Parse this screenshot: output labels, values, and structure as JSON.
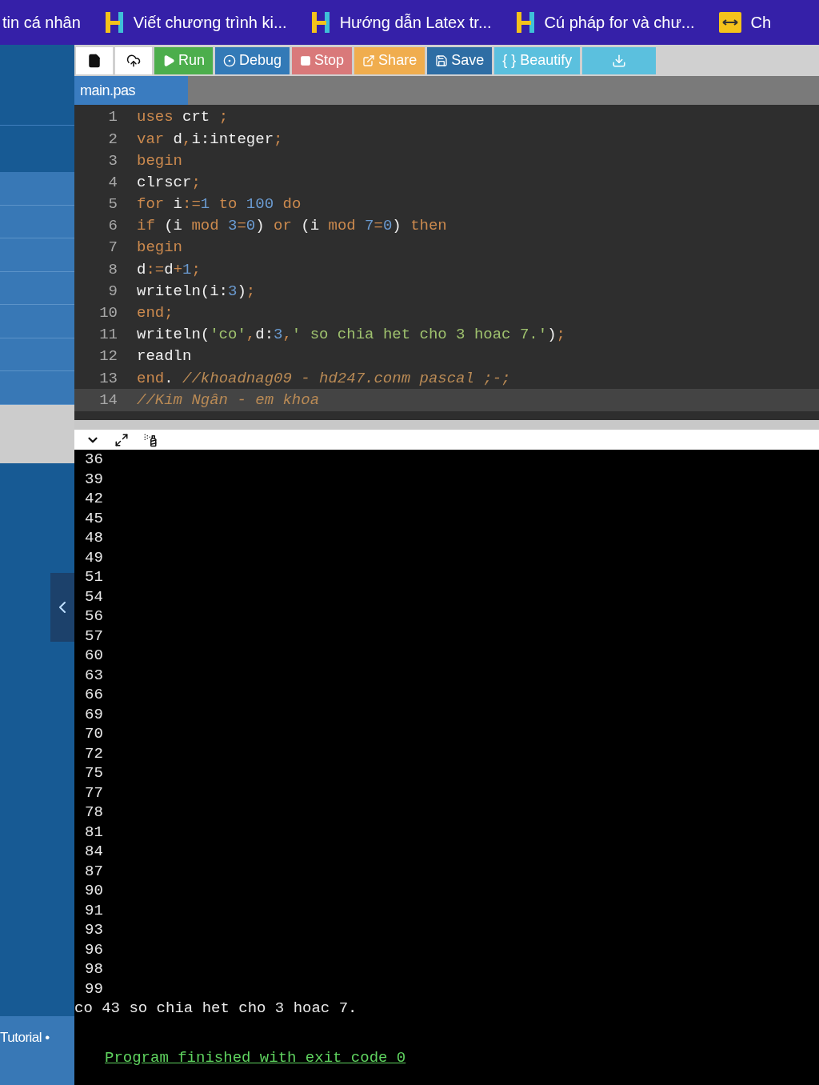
{
  "bookmarks_bar": {
    "items": [
      {
        "label": "tin cá nhân",
        "kind": "text"
      },
      {
        "label": "Viết chương trình ki...",
        "kind": "h-logo"
      },
      {
        "label": "Hướng dẫn Latex tr...",
        "kind": "h-logo"
      },
      {
        "label": "Cú pháp for và chư...",
        "kind": "h-logo"
      },
      {
        "label": "Ch",
        "kind": "arrows"
      }
    ]
  },
  "sidebar": {
    "footer_link": "Tutorial •"
  },
  "toolbar": {
    "buttons": [
      {
        "kind": "new-file",
        "color": "#ffffff"
      },
      {
        "kind": "upload",
        "color": "#ffffff"
      },
      {
        "kind": "run",
        "label": "Run",
        "color": "#4cae4c"
      },
      {
        "kind": "debug",
        "label": "Debug",
        "color": "#337ab7"
      },
      {
        "kind": "stop",
        "label": "Stop",
        "color": "#d9797a"
      },
      {
        "kind": "share",
        "label": "Share",
        "color": "#f0ad4e"
      },
      {
        "kind": "save",
        "label": "Save",
        "color": "#2e6da4"
      },
      {
        "kind": "beautify",
        "label": "{ } Beautify",
        "color": "#5bc0de"
      },
      {
        "kind": "download",
        "color": "#5bc0de"
      }
    ]
  },
  "tabs": [
    {
      "label": "main.pas",
      "selected": true
    }
  ],
  "editor": {
    "lines": [
      {
        "number": "1",
        "active": false,
        "tokens": [
          {
            "text": "uses",
            "kind": "keyword"
          },
          {
            "text": " crt ",
            "kind": "plain"
          },
          {
            "text": ";",
            "kind": "punct"
          }
        ]
      },
      {
        "number": "2",
        "active": false,
        "tokens": [
          {
            "text": "var",
            "kind": "keyword"
          },
          {
            "text": " d",
            "kind": "plain"
          },
          {
            "text": ",",
            "kind": "punct"
          },
          {
            "text": "i:integer",
            "kind": "plain"
          },
          {
            "text": ";",
            "kind": "punct"
          }
        ]
      },
      {
        "number": "3",
        "active": false,
        "tokens": [
          {
            "text": "begin",
            "kind": "keyword"
          }
        ]
      },
      {
        "number": "4",
        "active": false,
        "tokens": [
          {
            "text": "clrscr",
            "kind": "plain"
          },
          {
            "text": ";",
            "kind": "punct"
          }
        ]
      },
      {
        "number": "5",
        "active": false,
        "tokens": [
          {
            "text": "for",
            "kind": "keyword"
          },
          {
            "text": " i",
            "kind": "plain"
          },
          {
            "text": ":=",
            "kind": "punct"
          },
          {
            "text": "1",
            "kind": "number"
          },
          {
            "text": " to",
            "kind": "keyword"
          },
          {
            "text": " 100",
            "kind": "number"
          },
          {
            "text": " do",
            "kind": "keyword"
          }
        ]
      },
      {
        "number": "6",
        "active": false,
        "tokens": [
          {
            "text": "if",
            "kind": "keyword"
          },
          {
            "text": " (i ",
            "kind": "plain"
          },
          {
            "text": "mod",
            "kind": "keyword"
          },
          {
            "text": " 3",
            "kind": "number"
          },
          {
            "text": "=",
            "kind": "punct"
          },
          {
            "text": "0",
            "kind": "number"
          },
          {
            "text": ") ",
            "kind": "plain"
          },
          {
            "text": "or",
            "kind": "keyword"
          },
          {
            "text": " (i ",
            "kind": "plain"
          },
          {
            "text": "mod",
            "kind": "keyword"
          },
          {
            "text": " 7",
            "kind": "number"
          },
          {
            "text": "=",
            "kind": "punct"
          },
          {
            "text": "0",
            "kind": "number"
          },
          {
            "text": ") ",
            "kind": "plain"
          },
          {
            "text": "then",
            "kind": "keyword"
          }
        ]
      },
      {
        "number": "7",
        "active": false,
        "tokens": [
          {
            "text": "begin",
            "kind": "keyword"
          }
        ]
      },
      {
        "number": "8",
        "active": false,
        "tokens": [
          {
            "text": "d",
            "kind": "plain"
          },
          {
            "text": ":=",
            "kind": "punct"
          },
          {
            "text": "d",
            "kind": "plain"
          },
          {
            "text": "+",
            "kind": "punct"
          },
          {
            "text": "1",
            "kind": "number"
          },
          {
            "text": ";",
            "kind": "punct"
          }
        ]
      },
      {
        "number": "9",
        "active": false,
        "tokens": [
          {
            "text": "writeln(i:",
            "kind": "plain"
          },
          {
            "text": "3",
            "kind": "number"
          },
          {
            "text": ")",
            "kind": "plain"
          },
          {
            "text": ";",
            "kind": "punct"
          }
        ]
      },
      {
        "number": "10",
        "active": false,
        "tokens": [
          {
            "text": "end",
            "kind": "keyword"
          },
          {
            "text": ";",
            "kind": "punct"
          }
        ]
      },
      {
        "number": "11",
        "active": false,
        "tokens": [
          {
            "text": "writeln(",
            "kind": "plain"
          },
          {
            "text": "'co'",
            "kind": "string"
          },
          {
            "text": ",",
            "kind": "punct"
          },
          {
            "text": "d:",
            "kind": "plain"
          },
          {
            "text": "3",
            "kind": "number"
          },
          {
            "text": ",",
            "kind": "punct"
          },
          {
            "text": "' so chia het cho 3 hoac 7.'",
            "kind": "string"
          },
          {
            "text": ")",
            "kind": "plain"
          },
          {
            "text": ";",
            "kind": "punct"
          }
        ]
      },
      {
        "number": "12",
        "active": false,
        "tokens": [
          {
            "text": "readln",
            "kind": "plain"
          }
        ]
      },
      {
        "number": "13",
        "active": false,
        "tokens": [
          {
            "text": "end",
            "kind": "keyword"
          },
          {
            "text": ". ",
            "kind": "plain"
          },
          {
            "text": "//khoadnag09 - hd247.conm pascal ;-;",
            "kind": "comment"
          }
        ]
      },
      {
        "number": "14",
        "active": true,
        "tokens": [
          {
            "text": "//Kim Ngân - em khoa",
            "kind": "comment"
          }
        ]
      }
    ]
  },
  "output": {
    "lines": [
      "36",
      "39",
      "42",
      "45",
      "48",
      "49",
      "51",
      "54",
      "56",
      "57",
      "60",
      "63",
      "66",
      "69",
      "70",
      "72",
      "75",
      "77",
      "78",
      "81",
      "84",
      "87",
      "90",
      "91",
      "93",
      "96",
      "98",
      "99"
    ],
    "summary": "co 43 so chia het cho 3 hoac 7.",
    "status": "Program finished with exit code 0"
  }
}
